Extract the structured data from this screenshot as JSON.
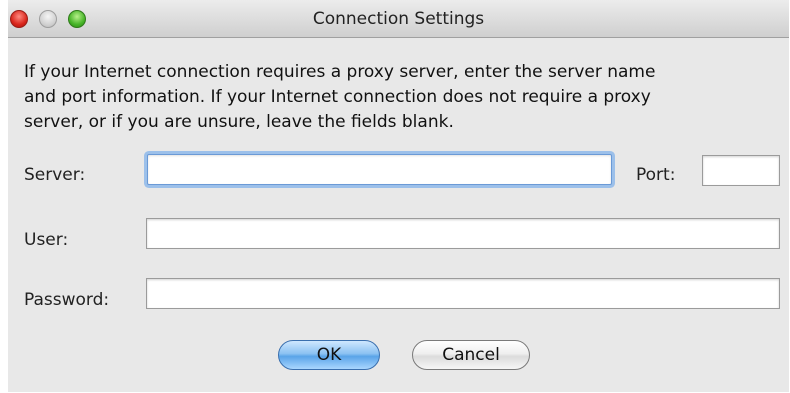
{
  "window": {
    "title": "Connection Settings"
  },
  "intro_text": "If your Internet connection requires a proxy server, enter the server name\nand port information. If your Internet connection does not require a proxy\nserver, or if you are unsure, leave the fields blank.",
  "fields": {
    "server": {
      "label": "Server:",
      "value": ""
    },
    "port": {
      "label": "Port:",
      "value": ""
    },
    "user": {
      "label": "User:",
      "value": ""
    },
    "password": {
      "label": "Password:",
      "value": ""
    }
  },
  "buttons": {
    "ok": "OK",
    "cancel": "Cancel"
  },
  "colors": {
    "window_bg": "#e8e8e8",
    "focus_ring": "#9cc0ea",
    "ok_button": "#5aa4e8"
  }
}
